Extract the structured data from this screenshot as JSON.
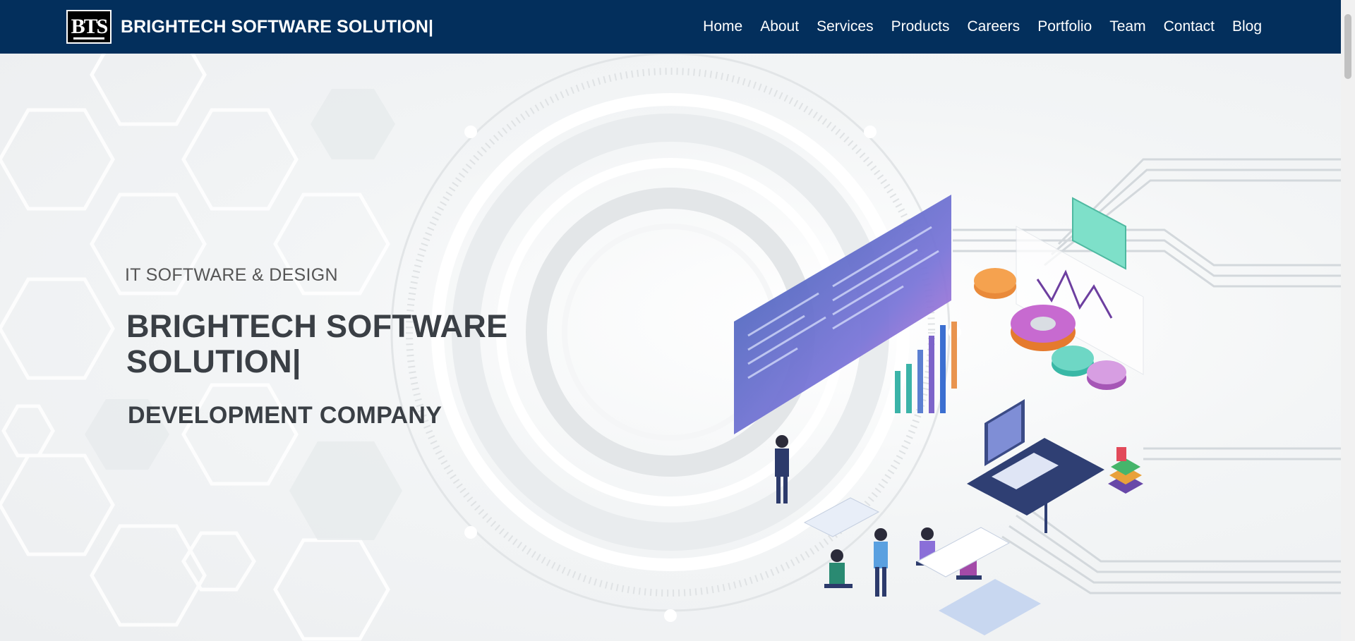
{
  "header": {
    "logo_text": "BTS",
    "brand_name": "BRIGHTECH SOFTWARE SOLUTION|"
  },
  "nav": {
    "items": [
      "Home",
      "About",
      "Services",
      "Products",
      "Careers",
      "Portfolio",
      "Team",
      "Contact",
      "Blog"
    ]
  },
  "hero": {
    "eyebrow": "IT SOFTWARE & DESIGN",
    "title": "BRIGHTECH SOFTWARE SOLUTION|",
    "subtitle": "DEVELOPMENT COMPANY"
  },
  "colors": {
    "header_bg": "#032f5c",
    "title_text": "#3a3f45"
  }
}
